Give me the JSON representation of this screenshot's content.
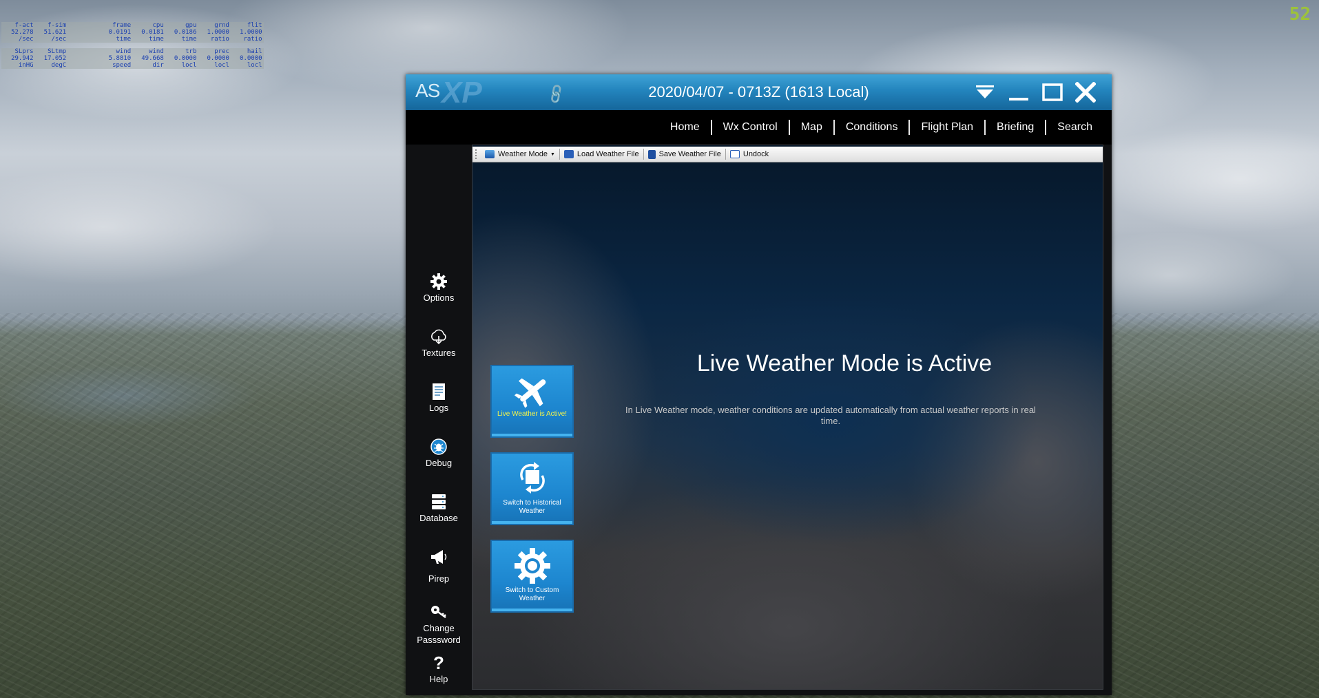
{
  "stats": {
    "row1": {
      "top": [
        "f-act",
        "f-sim",
        "",
        "frame",
        "cpu",
        "gpu",
        "grnd",
        "flit"
      ],
      "mid": [
        "52.278",
        "51.621",
        "",
        "0.0191",
        "0.0181",
        "0.0186",
        "1.0000",
        "1.0000"
      ],
      "bot": [
        "/sec",
        "/sec",
        "",
        "time",
        "time",
        "time",
        "ratio",
        "ratio"
      ]
    },
    "row2": {
      "top": [
        "SLprs",
        "SLtmp",
        "",
        "wind",
        "wind",
        "trb",
        "prec",
        "hail"
      ],
      "mid": [
        "29.942",
        "17.052",
        "",
        "5.8810",
        "49.668",
        "0.0000",
        "0.0000",
        "0.0000"
      ],
      "bot": [
        "inHG",
        "degC",
        "",
        "speed",
        "dir",
        "locl",
        "locl",
        "locl"
      ]
    },
    "fps": "52"
  },
  "window": {
    "logo_as": "AS",
    "logo_xp": "XP",
    "title": "2020/04/07 - 0713Z (1613 Local)"
  },
  "nav": [
    "Home",
    "Wx Control",
    "Map",
    "Conditions",
    "Flight Plan",
    "Briefing",
    "Search"
  ],
  "sidebar": [
    {
      "label": "Options",
      "icon": "gear-icon"
    },
    {
      "label": "Textures",
      "icon": "cloud-download-icon"
    },
    {
      "label": "Logs",
      "icon": "document-icon"
    },
    {
      "label": "Debug",
      "icon": "bug-icon"
    },
    {
      "label": "Database",
      "icon": "database-icon"
    },
    {
      "label": "Pirep",
      "icon": "megaphone-icon"
    },
    {
      "label": "Change Passsword",
      "icon": "key-icon"
    },
    {
      "label": "Help",
      "icon": "help-icon"
    }
  ],
  "toolbar": {
    "weather_mode": "Weather Mode",
    "load": "Load Weather File",
    "save": "Save Weather File",
    "undock": "Undock"
  },
  "modes": [
    {
      "label": "Live Weather is Active!",
      "icon": "airplane-icon",
      "active": true
    },
    {
      "label": "Switch to Historical Weather",
      "icon": "swap-icon",
      "active": false
    },
    {
      "label": "Switch to Custom Weather",
      "icon": "gear-icon",
      "active": false
    }
  ],
  "main": {
    "headline": "Live Weather Mode is Active",
    "description": "In Live Weather mode, weather conditions are updated automatically from actual weather reports in real time."
  },
  "colors": {
    "titlebar": "#2384bd",
    "mode_button": "#1d86cf",
    "active_label": "#f4f44a",
    "fps": "#9dc23b"
  }
}
